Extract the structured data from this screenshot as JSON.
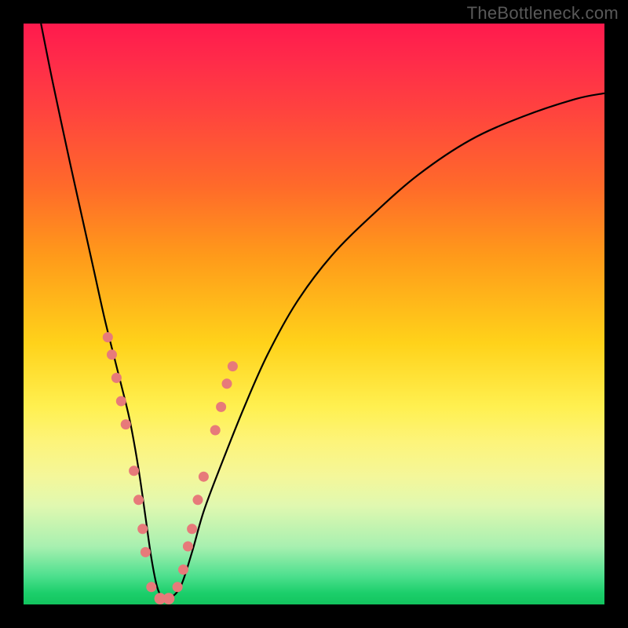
{
  "watermark": "TheBottleneck.com",
  "colors": {
    "frame": "#000000",
    "gradient_top": "#ff1a4d",
    "gradient_bottom": "#12c45e",
    "curve": "#000000",
    "dot": "#e77a7a",
    "watermark": "#595959"
  },
  "chart_data": {
    "type": "line",
    "title": "",
    "xlabel": "",
    "ylabel": "",
    "xlim": [
      0,
      100
    ],
    "ylim": [
      0,
      100
    ],
    "grid": false,
    "legend": false,
    "series": [
      {
        "name": "bottleneck-curve",
        "x": [
          3,
          5,
          8,
          10,
          12,
          14,
          16,
          18,
          19,
          20,
          21,
          22,
          23,
          24,
          25,
          27,
          29,
          31,
          34,
          38,
          42,
          47,
          53,
          60,
          68,
          77,
          86,
          95,
          100
        ],
        "y": [
          100,
          90,
          76,
          67,
          58,
          49,
          41,
          33,
          28,
          22,
          15,
          8,
          3,
          1,
          1,
          3,
          9,
          16,
          24,
          34,
          43,
          52,
          60,
          67,
          74,
          80,
          84,
          87,
          88
        ]
      }
    ],
    "markers": [
      {
        "x": 14.5,
        "y": 46,
        "r": 1.6
      },
      {
        "x": 15.2,
        "y": 43,
        "r": 1.6
      },
      {
        "x": 16.0,
        "y": 39,
        "r": 1.6
      },
      {
        "x": 16.8,
        "y": 35,
        "r": 1.6
      },
      {
        "x": 17.6,
        "y": 31,
        "r": 1.6
      },
      {
        "x": 19.0,
        "y": 23,
        "r": 1.6
      },
      {
        "x": 19.8,
        "y": 18,
        "r": 1.6
      },
      {
        "x": 20.5,
        "y": 13,
        "r": 1.6
      },
      {
        "x": 21.0,
        "y": 9,
        "r": 1.6
      },
      {
        "x": 22.0,
        "y": 3,
        "r": 1.6
      },
      {
        "x": 23.5,
        "y": 1,
        "r": 1.8
      },
      {
        "x": 25.0,
        "y": 1,
        "r": 1.8
      },
      {
        "x": 26.5,
        "y": 3,
        "r": 1.6
      },
      {
        "x": 27.5,
        "y": 6,
        "r": 1.6
      },
      {
        "x": 28.3,
        "y": 10,
        "r": 1.6
      },
      {
        "x": 29.0,
        "y": 13,
        "r": 1.6
      },
      {
        "x": 30.0,
        "y": 18,
        "r": 1.6
      },
      {
        "x": 31.0,
        "y": 22,
        "r": 1.6
      },
      {
        "x": 33.0,
        "y": 30,
        "r": 1.6
      },
      {
        "x": 34.0,
        "y": 34,
        "r": 1.6
      },
      {
        "x": 35.0,
        "y": 38,
        "r": 1.6
      },
      {
        "x": 36.0,
        "y": 41,
        "r": 1.6
      }
    ],
    "background_gradient_meaning": "color scale from red (high bottleneck) at top to green (no bottleneck) at bottom"
  }
}
